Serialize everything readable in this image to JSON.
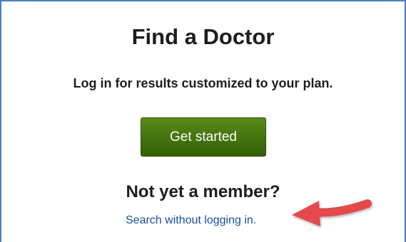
{
  "find_doctor": {
    "title": "Find a Doctor",
    "subtitle": "Log in for results customized to your plan.",
    "get_started_label": "Get started",
    "not_member_heading": "Not yet a member?",
    "search_link_label": "Search without logging in."
  },
  "colors": {
    "frame_border": "#4a7fc4",
    "button_green": "#46750f",
    "link_blue": "#1f4ea2",
    "annotation_arrow": "#e5484d"
  },
  "annotation": {
    "icon": "red-pointer-arrow-icon"
  }
}
